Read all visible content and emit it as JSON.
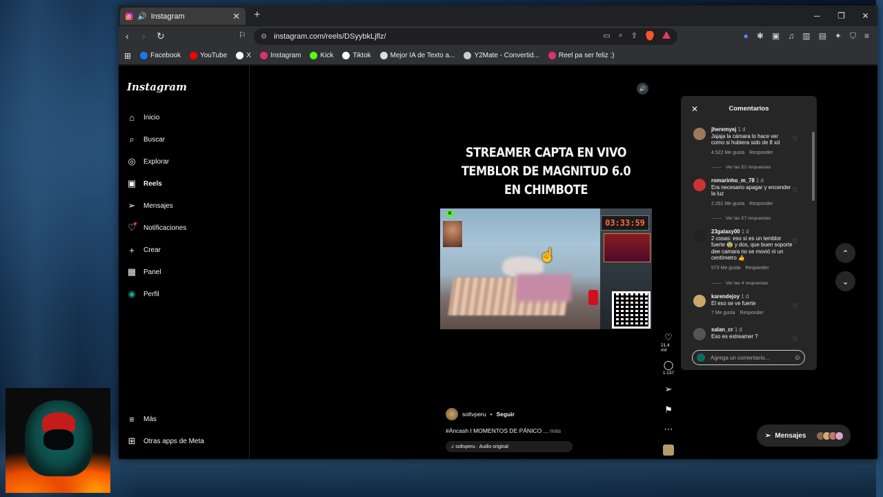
{
  "tab": {
    "title": "Instagram"
  },
  "address": {
    "url": "instagram.com/reels/DSyybkLjflz/"
  },
  "bookmarks": [
    {
      "label": "Facebook",
      "color": "#1877f2"
    },
    {
      "label": "YouTube",
      "color": "#ff0000"
    },
    {
      "label": "X",
      "color": "#ffffff"
    },
    {
      "label": "Instagram",
      "color": "#e1306c"
    },
    {
      "label": "Kick",
      "color": "#53fc18"
    },
    {
      "label": "Tiktok",
      "color": "#ffffff"
    },
    {
      "label": "Mejor IA de Texto a...",
      "color": "#dddddd"
    },
    {
      "label": "Y2Mate - Convertid...",
      "color": "#cccccc"
    },
    {
      "label": "Reel pa ser feliz :)",
      "color": "#e1306c"
    }
  ],
  "sidebar": {
    "logo": "Instagram",
    "items": [
      {
        "label": "Inicio",
        "icon": "home-icon"
      },
      {
        "label": "Buscar",
        "icon": "search-icon"
      },
      {
        "label": "Explorar",
        "icon": "compass-icon"
      },
      {
        "label": "Reels",
        "icon": "reels-icon"
      },
      {
        "label": "Mensajes",
        "icon": "send-icon"
      },
      {
        "label": "Notificaciones",
        "icon": "heart-icon"
      },
      {
        "label": "Crear",
        "icon": "plus-icon"
      },
      {
        "label": "Panel",
        "icon": "chart-icon"
      },
      {
        "label": "Perfil",
        "icon": "profile-icon"
      }
    ],
    "more": "Más",
    "meta_apps": "Otras apps de Meta"
  },
  "reel": {
    "headline": [
      "STREAMER CAPTA EN VIVO",
      "TEMBLOR DE MAGNITUD 6.0",
      "EN CHIMBOTE"
    ],
    "timer": "03:33:59",
    "author": "soltvperu",
    "follow": "Seguir",
    "caption": "#Áncash I MOMENTOS DE PÁNICO ...",
    "caption_more": "más",
    "audio": "soltvperu · Audio original",
    "likes": "21,4 mil",
    "comments_count": "1.137"
  },
  "comments": {
    "title": "Comentarios",
    "input_placeholder": "Agrega un comentario...",
    "items": [
      {
        "user": "jheremyej",
        "time": "1 d",
        "text": "Jajaja la cámara lo hace ver como si hubiera sido de 8 xd",
        "likes": "4.522 Me gusta",
        "reply": "Responder",
        "replies": "Ver las 52 respuestas"
      },
      {
        "user": "romarinho_m_78",
        "time": "1 d",
        "text": "Era necesario apagar y encender la luz",
        "likes": "2.261 Me gusta",
        "reply": "Responder",
        "replies": "Ver las 57 respuestas"
      },
      {
        "user": "23galaxy00",
        "time": "1 d",
        "text": "2 cosas: eso sí es un temblor fuerte 😨 y dos, que buen soporte dee camara no se movió ni un centímetro 👍",
        "likes": "573 Me gusta",
        "reply": "Responder",
        "replies": "Ver las 4 respuestas"
      },
      {
        "user": "karendejoy",
        "time": "1 d",
        "text": "El eso se ve fuerte",
        "likes": "7 Me gusta",
        "reply": "Responder",
        "replies": ""
      },
      {
        "user": "salan_cr",
        "time": "1 d",
        "text": "Eso es estreamer ?",
        "likes": "",
        "reply": "",
        "replies": ""
      }
    ]
  },
  "messages_button": {
    "label": "Mensajes"
  }
}
